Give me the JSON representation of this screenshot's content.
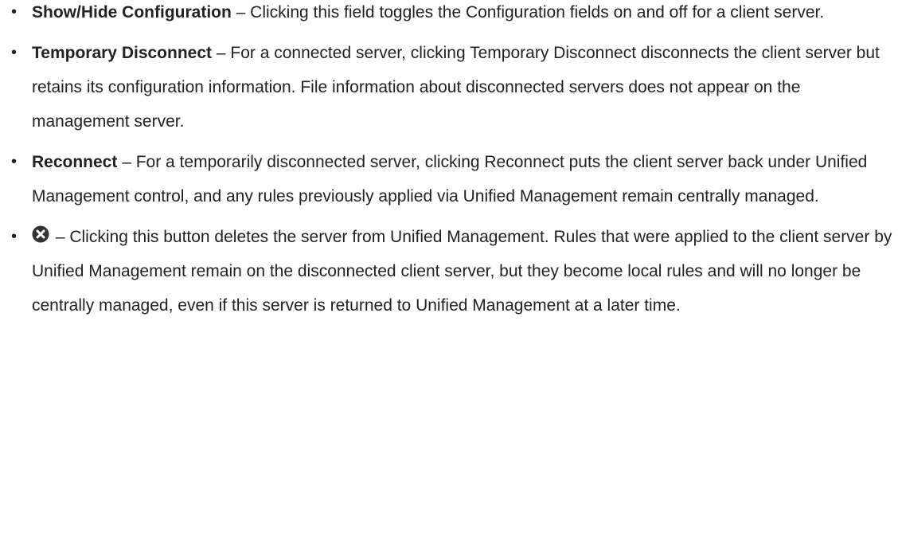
{
  "items": [
    {
      "term": "Show/Hide Configuration",
      "text": " – Clicking this field toggles the Configuration fields on and off for a client server."
    },
    {
      "term": "Temporary Disconnect",
      "text": " – For a connected server, clicking Temporary Disconnect disconnects the client server but retains its configuration information. File information about disconnected servers does not appear on the management server."
    },
    {
      "term": "Reconnect",
      "text": " – For a temporarily disconnected server, clicking Reconnect puts the client server back under Unified Management control, and any rules previously applied via Unified Management remain centrally managed."
    },
    {
      "icon": "close-circle-icon",
      "text": " – Clicking this button deletes the server from Unified Management. Rules that were applied to the client server by Unified Management remain on the disconnected client server, but they become local rules and will no longer be centrally managed, even if this server is returned to Unified Management at a later time."
    }
  ],
  "bullet_char": "•",
  "colors": {
    "text": "#222222",
    "icon": "#333333"
  }
}
